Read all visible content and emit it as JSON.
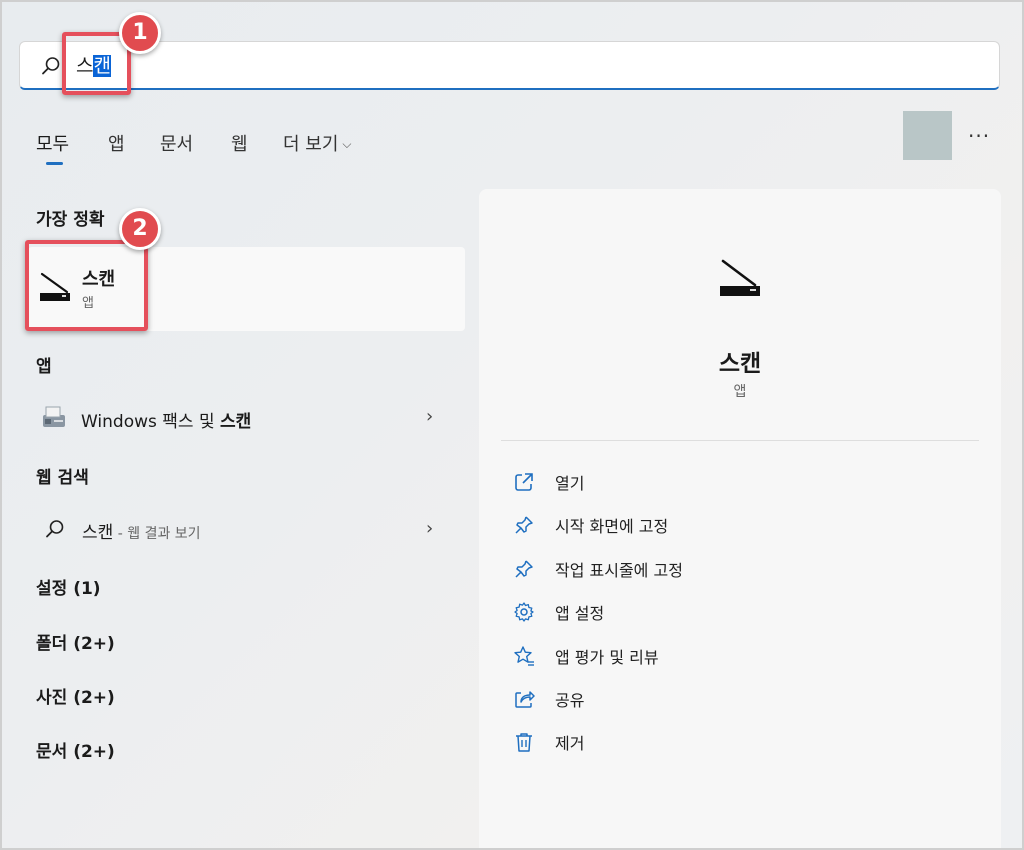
{
  "search": {
    "query_prefix": "스",
    "query_selected": "캔"
  },
  "annotations": {
    "badge1": "1",
    "badge2": "2",
    "color": "#e14b4f"
  },
  "tabs": [
    {
      "label": "모두",
      "active": true
    },
    {
      "label": "앱"
    },
    {
      "label": "문서"
    },
    {
      "label": "웹"
    },
    {
      "label": "더 보기",
      "chevron": "⌵"
    }
  ],
  "more_label": "···",
  "left": {
    "best_match_title": "가장 정확",
    "best_match": {
      "name": "스캔",
      "type": "앱",
      "icon": "scanner-icon"
    },
    "apps_title": "앱",
    "app_item": {
      "prefix": "Windows 팩스 및 ",
      "bold": "스캔",
      "icon": "fax-scan-icon"
    },
    "web_title": "웹 검색",
    "web_item": {
      "query": "스캔",
      "suffix": " - 웹 결과 보기",
      "icon": "search-icon"
    },
    "categories": [
      "설정 (1)",
      "폴더 (2+)",
      "사진 (2+)",
      "문서 (2+)"
    ]
  },
  "panel": {
    "name": "스캔",
    "type": "앱",
    "actions": [
      {
        "label": "열기",
        "icon": "open-external-icon"
      },
      {
        "label": "시작 화면에 고정",
        "icon": "pin-icon"
      },
      {
        "label": "작업 표시줄에 고정",
        "icon": "pin-icon"
      },
      {
        "label": "앱 설정",
        "icon": "gear-icon"
      },
      {
        "label": "앱 평가 및 리뷰",
        "icon": "star-review-icon"
      },
      {
        "label": "공유",
        "icon": "share-icon"
      },
      {
        "label": "제거",
        "icon": "trash-icon"
      }
    ]
  },
  "colors": {
    "accent": "#1f6fc0",
    "annotation": "#e5505c"
  }
}
